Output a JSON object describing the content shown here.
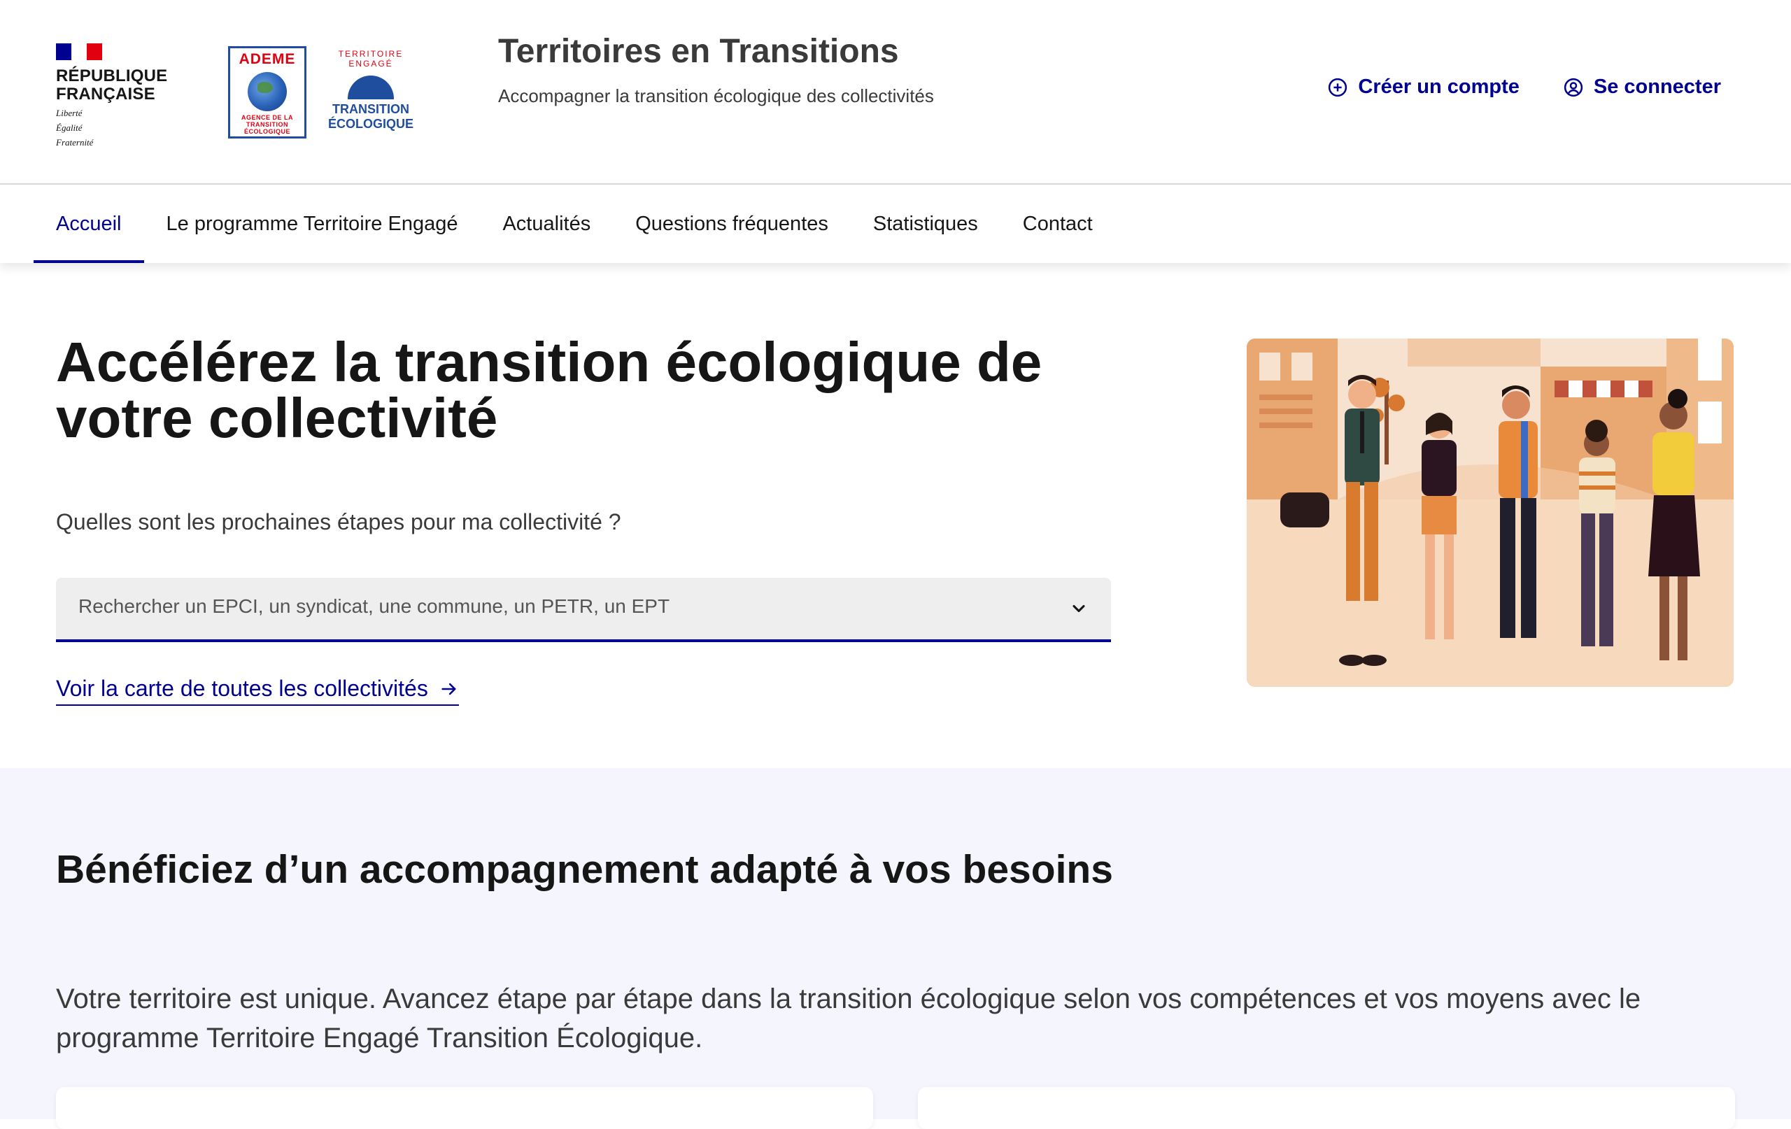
{
  "header": {
    "republique": {
      "line1": "RÉPUBLIQUE",
      "line2": "FRANÇAISE",
      "motto1": "Liberté",
      "motto2": "Égalité",
      "motto3": "Fraternité"
    },
    "ademe_logo": {
      "word": "ADEME",
      "sub1": "AGENCE DE LA",
      "sub2": "TRANSITION",
      "sub3": "ÉCOLOGIQUE"
    },
    "te_logo": {
      "arc": "TERRITOIRE ENGAGÉ",
      "line1": "TRANSITION",
      "line2": "ÉCOLOGIQUE"
    },
    "site_title": "Territoires en Transitions",
    "tagline": "Accompagner la transition écologique des collectivités",
    "create_account": "Créer un compte",
    "login": "Se connecter"
  },
  "nav": {
    "items": [
      {
        "label": "Accueil",
        "active": true
      },
      {
        "label": "Le programme Territoire Engagé",
        "active": false
      },
      {
        "label": "Actualités",
        "active": false
      },
      {
        "label": "Questions fréquentes",
        "active": false
      },
      {
        "label": "Statistiques",
        "active": false
      },
      {
        "label": "Contact",
        "active": false
      }
    ]
  },
  "hero": {
    "title": "Accélérez la transition écologique de votre collectivité",
    "question": "Quelles sont les prochaines étapes pour ma collectivité ?",
    "search_placeholder": "Rechercher un EPCI, un syndicat, une commune, un PETR, un EPT",
    "map_link": "Voir la carte de toutes les collectivités"
  },
  "section2": {
    "title": "Bénéficiez d’un accompagnement adapté à vos besoins",
    "text": "Votre territoire est unique. Avancez étape par étape dans la transition écologique selon vos compétences et vos moyens avec le programme Territoire Engagé Transition Écologique."
  },
  "colors": {
    "primary": "#000091",
    "marianne_red": "#e1000f",
    "section_bg": "#f5f5fe",
    "hero_img_bg": "#f7e2d0"
  }
}
